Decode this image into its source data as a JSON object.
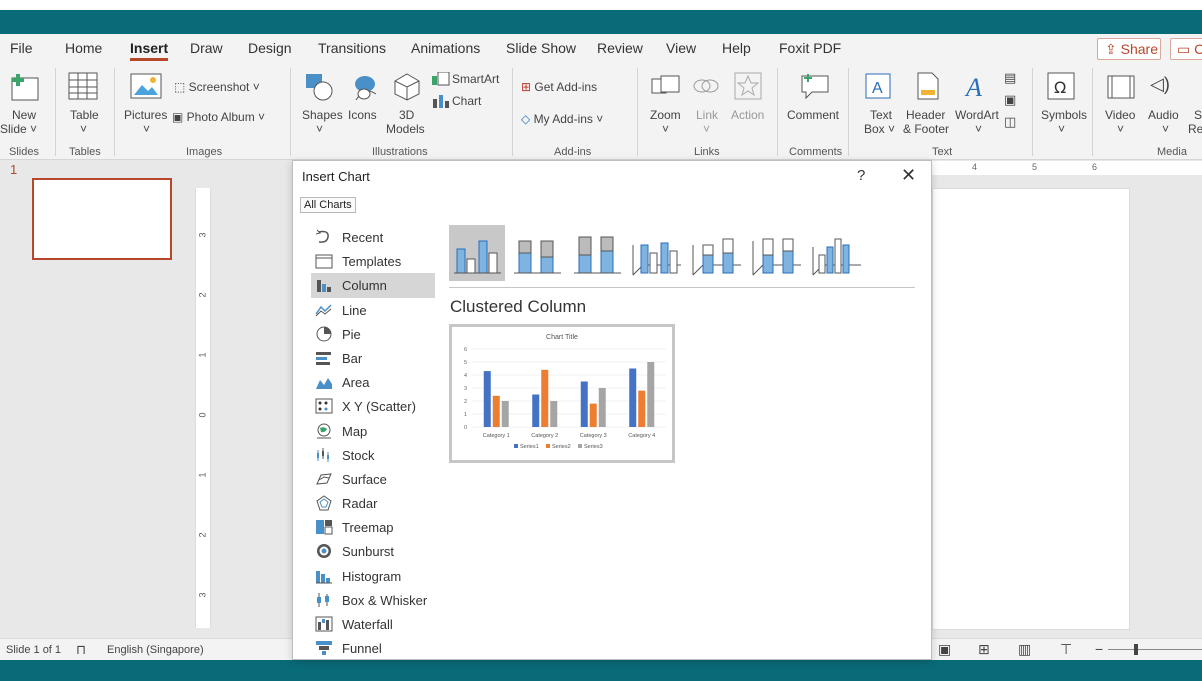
{
  "menu": {
    "tabs": [
      "File",
      "Home",
      "Insert",
      "Draw",
      "Design",
      "Transitions",
      "Animations",
      "Slide Show",
      "Review",
      "View",
      "Help",
      "Foxit PDF"
    ],
    "active_tab": "Insert",
    "share_label": "Share",
    "comments_label": "C"
  },
  "ribbon": {
    "new_slide": "New",
    "new_slide_2": "Slide ˅",
    "table": "Table",
    "pictures": "Pictures",
    "screenshot": "Screenshot ˅",
    "photo_album": "Photo Album ˅",
    "shapes": "Shapes",
    "icons": "Icons",
    "models_3d": "3D",
    "models_3d_2": "Models",
    "smartart": "SmartArt",
    "chart": "Chart",
    "get_addins": "Get Add-ins",
    "my_addins": "My Add-ins ˅",
    "zoom": "Zoom",
    "link": "Link",
    "action": "Action",
    "comment": "Comment",
    "text_box": "Text",
    "text_box_2": "Box ˅",
    "header_footer": "Header",
    "header_footer_2": "& Footer",
    "wordart": "WordArt",
    "symbols": "Symbols",
    "video": "Video",
    "audio": "Audio",
    "screen_rec": "S",
    "screen_rec_2": "Re",
    "groups": [
      "Slides",
      "Tables",
      "Images",
      "Illustrations",
      "Add-ins",
      "Links",
      "Comments",
      "Text",
      "Media"
    ]
  },
  "slide_panel": {
    "slide_number": "1"
  },
  "ruler": {
    "vertical": [
      "3",
      "2",
      "1",
      "0",
      "1",
      "2",
      "3"
    ],
    "horizontal": [
      "4",
      "5",
      "6"
    ]
  },
  "status": {
    "slide_info": "Slide 1 of 1",
    "language": "English (Singapore)"
  },
  "dialog": {
    "title": "Insert Chart",
    "help": "?",
    "close": "✕",
    "tab": "All Charts",
    "categories": [
      "Recent",
      "Templates",
      "Column",
      "Line",
      "Pie",
      "Bar",
      "Area",
      "X Y (Scatter)",
      "Map",
      "Stock",
      "Surface",
      "Radar",
      "Treemap",
      "Sunburst",
      "Histogram",
      "Box & Whisker",
      "Waterfall",
      "Funnel"
    ],
    "selected_category": "Column",
    "chart_type_title": "Clustered Column"
  },
  "colors": {
    "accent": "#b7472a",
    "teal": "#0a6b78",
    "series1": "#4472c4",
    "series2": "#ed7d31",
    "series3": "#a5a5a5"
  },
  "chart_data": {
    "type": "bar",
    "title": "Chart Title",
    "categories": [
      "Category 1",
      "Category 2",
      "Category 3",
      "Category 4"
    ],
    "series": [
      {
        "name": "Series1",
        "values": [
          4.3,
          2.5,
          3.5,
          4.5
        ]
      },
      {
        "name": "Series2",
        "values": [
          2.4,
          4.4,
          1.8,
          2.8
        ]
      },
      {
        "name": "Series3",
        "values": [
          2,
          2,
          3,
          5
        ]
      }
    ],
    "ylim": [
      0,
      6
    ],
    "yticks": [
      "0",
      "1",
      "2",
      "3",
      "4",
      "5",
      "6"
    ],
    "grid": true,
    "legend": "bottom"
  }
}
